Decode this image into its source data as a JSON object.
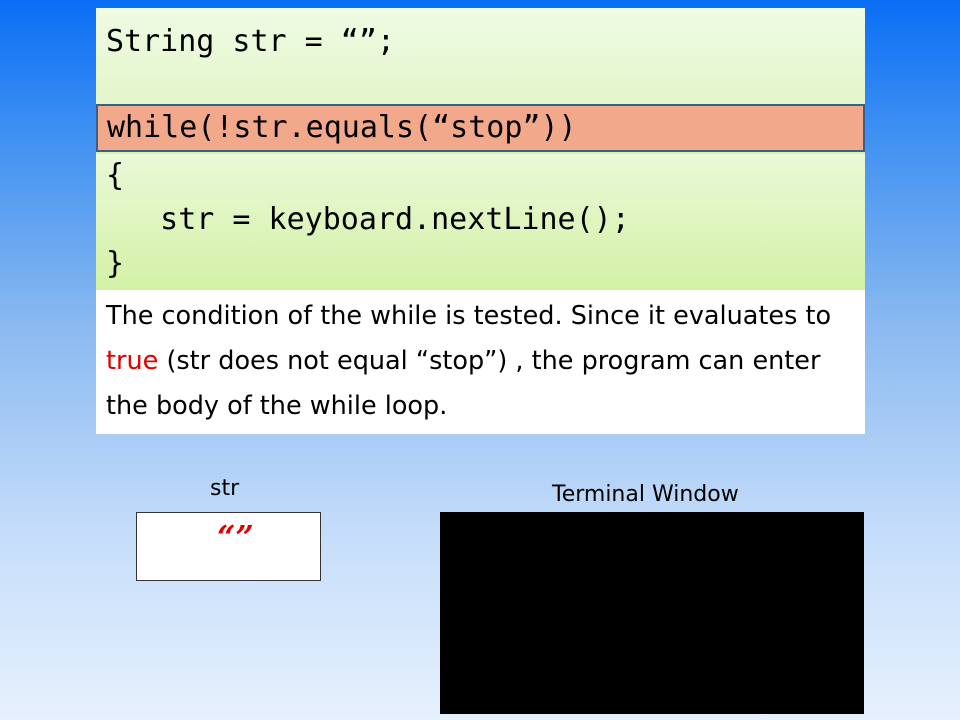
{
  "code": {
    "declaration": "String str = “”;",
    "condition": "while(!str.equals(“stop”))",
    "open_brace": "{",
    "body_line": "   str = keyboard.nextLine();",
    "close_brace": "}"
  },
  "explanation": {
    "part1": "The condition of the while is tested. Since it evaluates to ",
    "highlight": "true",
    "part2": " (str does not equal “stop”) , the program can enter the body of the while loop."
  },
  "variable": {
    "name": "str",
    "value": "“”"
  },
  "terminal": {
    "title": "Terminal Window"
  },
  "colors": {
    "highlight_line": "#f2a98b",
    "code_background": "#d4f2a8",
    "accent_red": "#e00000",
    "terminal_bg": "#000000"
  }
}
